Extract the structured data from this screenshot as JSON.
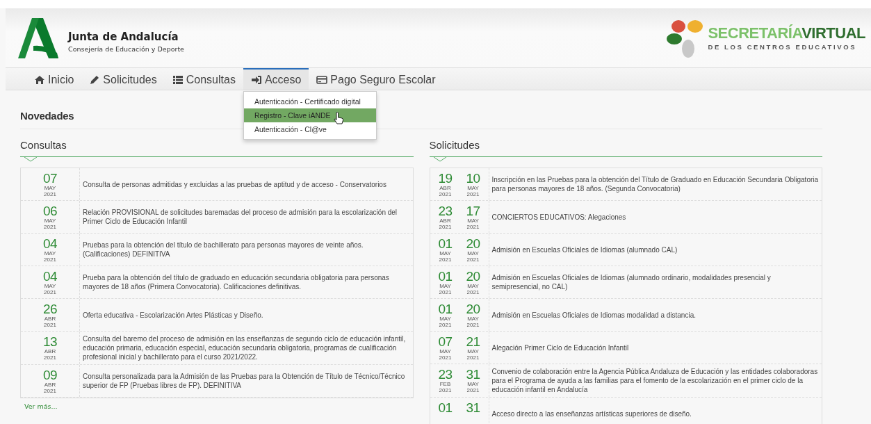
{
  "header": {
    "title": "Junta de Andalucía",
    "subtitle": "Consejería de Educación y Deporte",
    "brand_line1a": "SECRETARÍA",
    "brand_line1b": "VIRTUAL",
    "brand_line2": "DE LOS CENTROS EDUCATIVOS"
  },
  "nav": [
    {
      "label": "Inicio",
      "selected": false
    },
    {
      "label": "Solicitudes",
      "selected": false
    },
    {
      "label": "Consultas",
      "selected": false
    },
    {
      "label": "Acceso",
      "selected": true
    },
    {
      "label": "Pago Seguro Escolar",
      "selected": false
    }
  ],
  "dropdown": [
    {
      "label": "Autenticación - Certificado digital",
      "selected": false
    },
    {
      "label": "Registro - Clave iANDE",
      "selected": true
    },
    {
      "label": "Autenticación - Cl@ve",
      "selected": false
    }
  ],
  "section_title": "Novedades",
  "consultas": {
    "title": "Consultas",
    "more": "Ver más...",
    "rows": [
      {
        "date": {
          "day": "07",
          "month": "MAY",
          "year": "2021"
        },
        "text": "Consulta de personas admitidas y excluidas a las pruebas de aptitud y de acceso - Conservatorios"
      },
      {
        "date": {
          "day": "06",
          "month": "MAY",
          "year": "2021"
        },
        "text": "Relación PROVISIONAL de solicitudes baremadas del proceso de admisión para la escolarización del Primer Ciclo de Educación Infantil"
      },
      {
        "date": {
          "day": "04",
          "month": "MAY",
          "year": "2021"
        },
        "text": "Pruebas para la obtención del título de bachillerato para personas mayores de veinte años. (Calificaciones) DEFINITIVA"
      },
      {
        "date": {
          "day": "04",
          "month": "MAY",
          "year": "2021"
        },
        "text": "Prueba para la obtención del título de graduado en educación secundaria obligatoria para personas mayores de 18 años (Primera Convocatoria). Calificaciones definitivas."
      },
      {
        "date": {
          "day": "26",
          "month": "ABR",
          "year": "2021"
        },
        "text": "Oferta educativa - Escolarización Artes Plásticas y Diseño."
      },
      {
        "date": {
          "day": "13",
          "month": "ABR",
          "year": "2021"
        },
        "text": "Consulta del baremo del proceso de admisión en las enseñanzas de segundo ciclo de educación infantil, educación primaria, educación especial, educación secundaria obligatoria, programas de cualificación profesional inicial y bachillerato para el curso 2021/2022."
      },
      {
        "date": {
          "day": "09",
          "month": "ABR",
          "year": "2021"
        },
        "text": "Consulta personalizada para la Admisión de las Pruebas para la Obtención de Título de Técnico/Técnico superior de FP (Pruebas libres de FP). DEFINITIVA"
      }
    ]
  },
  "solicitudes": {
    "title": "Solicitudes",
    "rows": [
      {
        "start": {
          "day": "19",
          "month": "ABR",
          "year": "2021"
        },
        "end": {
          "day": "10",
          "month": "MAY",
          "year": "2021"
        },
        "text": "Inscripción en las Pruebas para la obtención del Título de Graduado en Educación Secundaria Obligatoria para personas mayores de 18 años. (Segunda Convocatoria)"
      },
      {
        "start": {
          "day": "23",
          "month": "ABR",
          "year": "2021"
        },
        "end": {
          "day": "17",
          "month": "MAY",
          "year": "2021"
        },
        "text": "CONCIERTOS EDUCATIVOS: Alegaciones"
      },
      {
        "start": {
          "day": "01",
          "month": "MAY",
          "year": "2021"
        },
        "end": {
          "day": "20",
          "month": "MAY",
          "year": "2021"
        },
        "text": "Admisión en Escuelas Oficiales de Idiomas (alumnado CAL)"
      },
      {
        "start": {
          "day": "01",
          "month": "MAY",
          "year": "2021"
        },
        "end": {
          "day": "20",
          "month": "MAY",
          "year": "2021"
        },
        "text": "Admisión en Escuelas Oficiales de Idiomas (alumnado ordinario, modalidades presencial y semipresencial, no CAL)"
      },
      {
        "start": {
          "day": "01",
          "month": "MAY",
          "year": "2021"
        },
        "end": {
          "day": "20",
          "month": "MAY",
          "year": "2021"
        },
        "text": "Admisión en Escuelas Oficiales de Idiomas modalidad a distancia."
      },
      {
        "start": {
          "day": "07",
          "month": "MAY",
          "year": "2021"
        },
        "end": {
          "day": "21",
          "month": "MAY",
          "year": "2021"
        },
        "text": "Alegación Primer Ciclo de Educación Infantil"
      },
      {
        "start": {
          "day": "23",
          "month": "FEB",
          "year": "2021"
        },
        "end": {
          "day": "31",
          "month": "MAY",
          "year": "2021"
        },
        "text": "Convenio de colaboración entre la Agencia Pública Andaluza de Educación y las entidades colaboradoras para el Programa de ayuda a las familias para el fomento de la escolarización en el primer ciclo de la educación infantil en Andalucía"
      },
      {
        "start": {
          "day": "01"
        },
        "end": {
          "day": "31"
        },
        "text": "Acceso directo a las enseñanzas artísticas superiores de diseño."
      }
    ]
  }
}
